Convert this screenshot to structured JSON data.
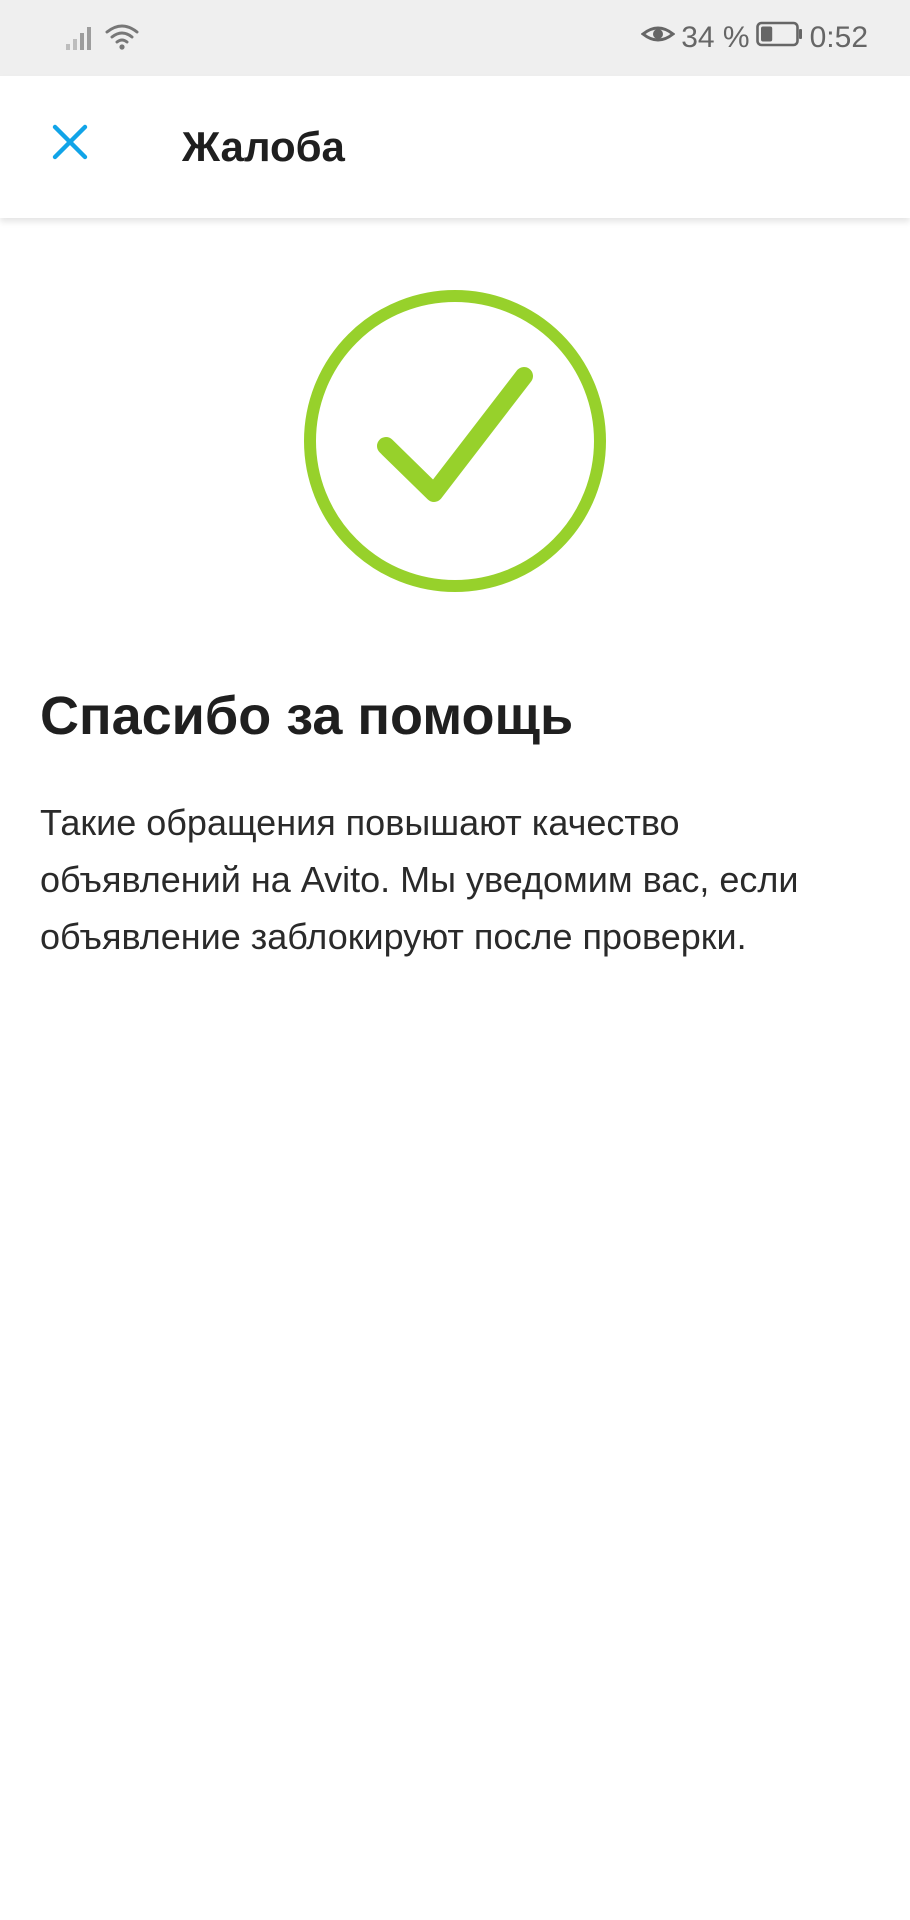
{
  "status_bar": {
    "battery_percent": "34 %",
    "time": "0:52",
    "icons": [
      "signal-icon",
      "wifi-icon",
      "eye-icon",
      "battery-icon"
    ],
    "battery_level": 0.34
  },
  "app_bar": {
    "title": "Жалоба",
    "close_icon": "close-icon",
    "accent_color": "#11a4e8"
  },
  "content": {
    "success_icon": "check-circle-icon",
    "success_color": "#97d12b",
    "heading": "Спасибо за помощь",
    "message": "Такие обращения повышают качество объявлений на Avito. Мы уведомим вас, если объявление заблокируют после проверки."
  }
}
